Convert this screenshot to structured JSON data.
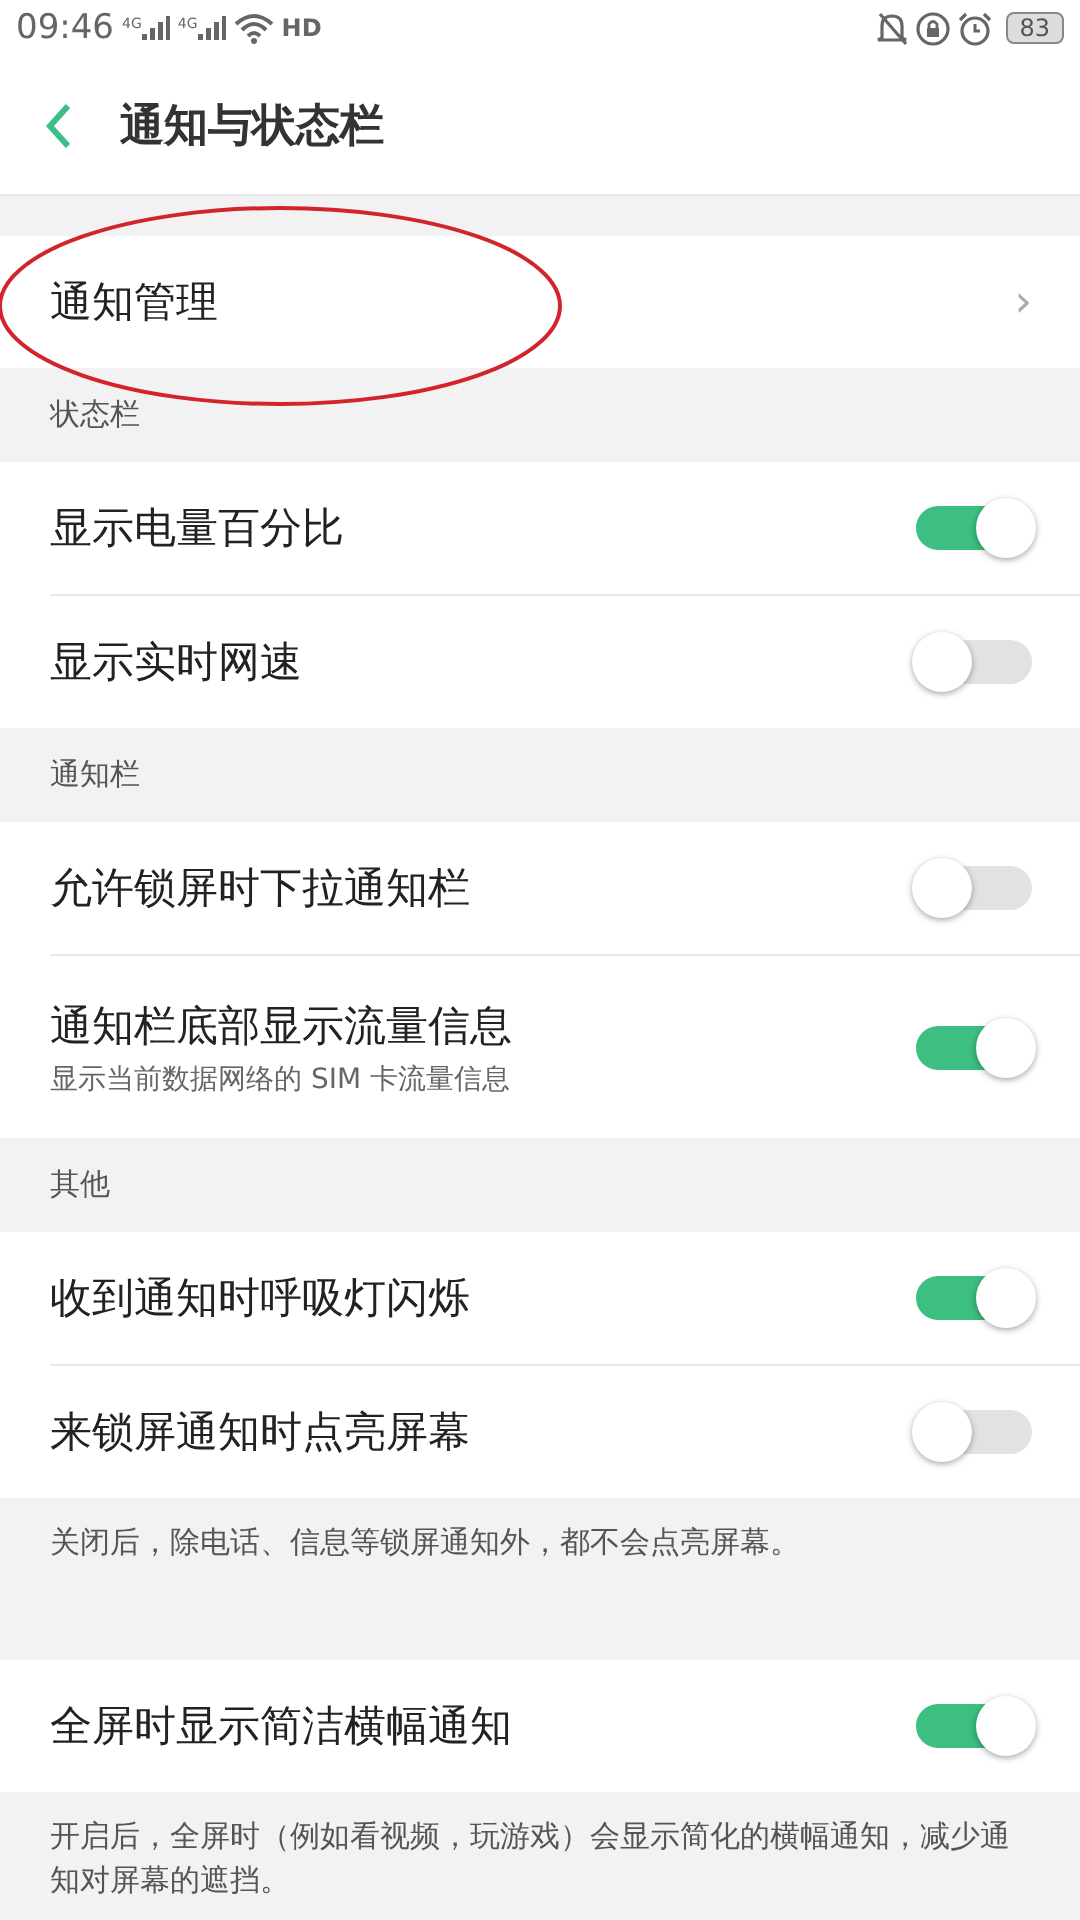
{
  "status_bar": {
    "time": "09:46",
    "signals": [
      "4G",
      "4G"
    ],
    "hd": "HD",
    "battery": "83"
  },
  "header": {
    "title": "通知与状态栏"
  },
  "sections": [
    {
      "items": [
        {
          "kind": "link",
          "label": "通知管理",
          "chevron": "›"
        }
      ]
    },
    {
      "header": "状态栏",
      "items": [
        {
          "kind": "toggle",
          "label": "显示电量百分比",
          "on": true
        },
        {
          "kind": "toggle",
          "label": "显示实时网速",
          "on": false
        }
      ]
    },
    {
      "header": "通知栏",
      "items": [
        {
          "kind": "toggle",
          "label": "允许锁屏时下拉通知栏",
          "on": false
        },
        {
          "kind": "toggle",
          "label": "通知栏底部显示流量信息",
          "sub": "显示当前数据网络的 SIM 卡流量信息",
          "on": true
        }
      ]
    },
    {
      "header": "其他",
      "items": [
        {
          "kind": "toggle",
          "label": "收到通知时呼吸灯闪烁",
          "on": true
        },
        {
          "kind": "toggle",
          "label": "来锁屏通知时点亮屏幕",
          "on": false
        }
      ],
      "note": "关闭后，除电话、信息等锁屏通知外，都不会点亮屏幕。"
    },
    {
      "items": [
        {
          "kind": "toggle",
          "label": "全屏时显示简洁横幅通知",
          "on": true
        }
      ],
      "note": "开启后，全屏时（例如看视频，玩游戏）会显示简化的横幅通知，减少通知对屏幕的遮挡。"
    }
  ],
  "annotation": {
    "kind": "ellipse",
    "color": "#d3242c"
  }
}
